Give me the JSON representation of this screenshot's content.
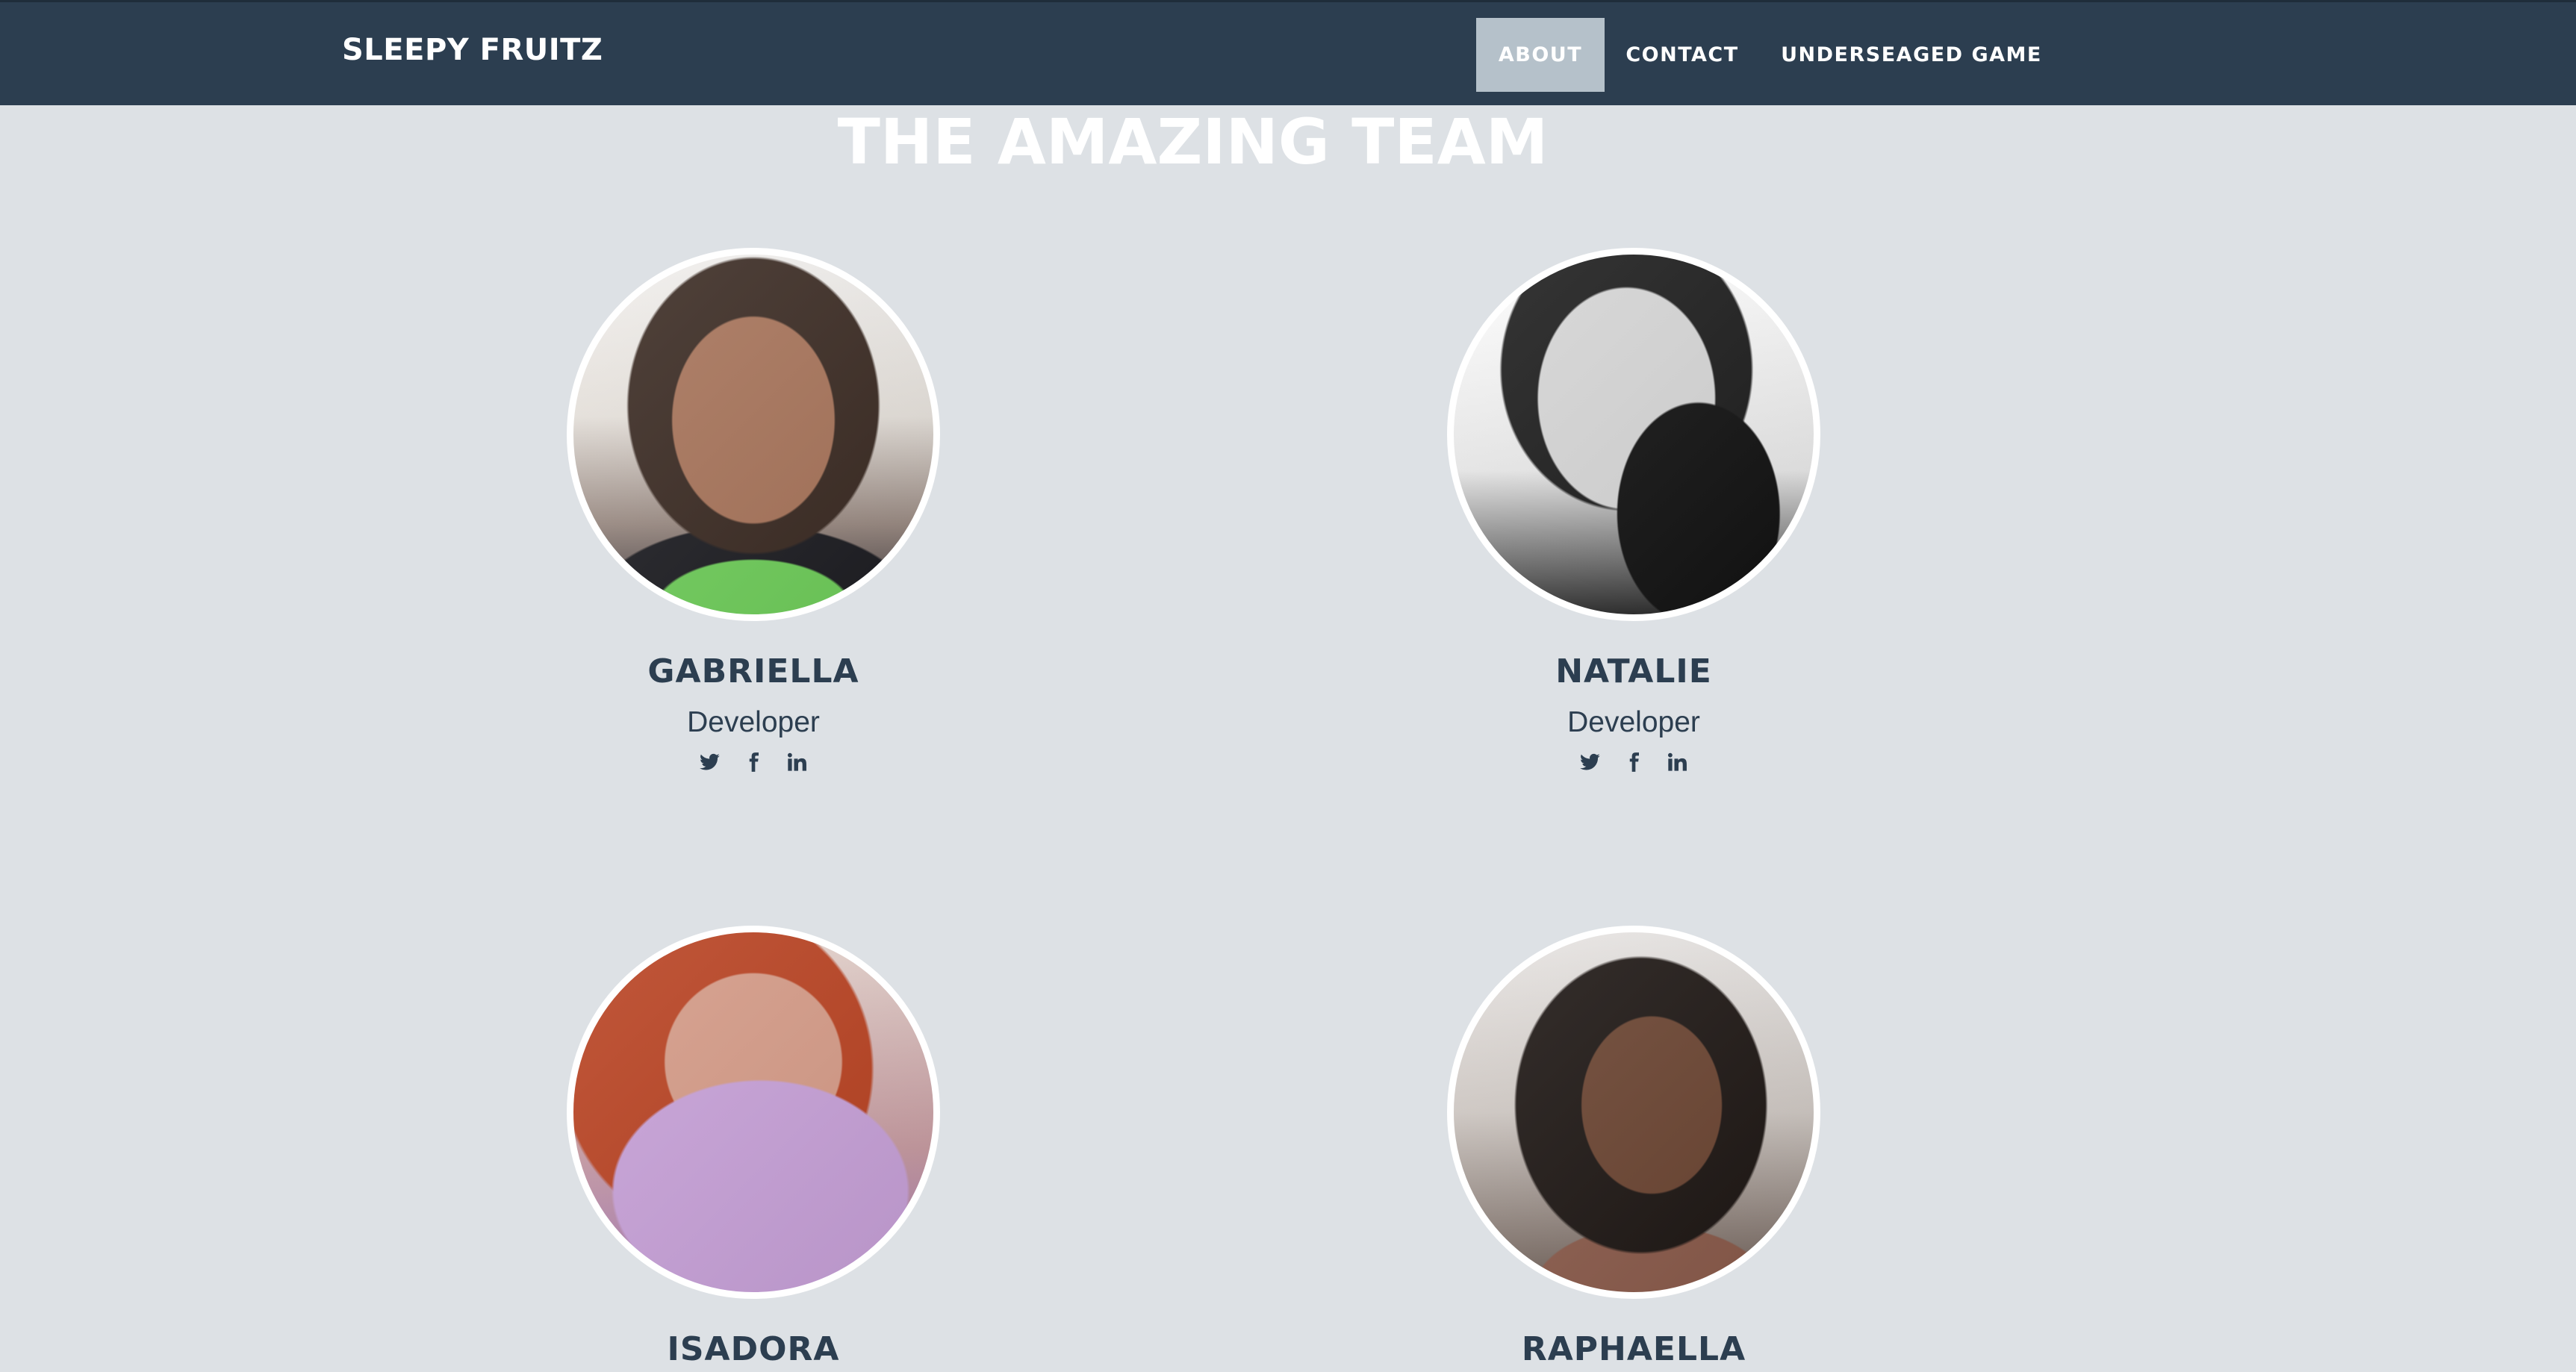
{
  "navbar": {
    "brand": "SLEEPY FRUITZ",
    "items": [
      {
        "label": "ABOUT",
        "active": true
      },
      {
        "label": "CONTACT",
        "active": false
      },
      {
        "label": "UNDERSEAGED GAME",
        "active": false
      }
    ]
  },
  "main": {
    "title": "THE AMAZING TEAM",
    "members": [
      {
        "name": "GABRIELLA",
        "role": "Developer",
        "socials": [
          "twitter-icon",
          "facebook-icon",
          "linkedin-icon"
        ]
      },
      {
        "name": "NATALIE",
        "role": "Developer",
        "socials": [
          "twitter-icon",
          "facebook-icon",
          "linkedin-icon"
        ]
      },
      {
        "name": "ISADORA"
      },
      {
        "name": "RAPHAELLA"
      }
    ]
  },
  "colors": {
    "navbar_bg": "#2c3e50",
    "active_nav_bg": "#b5c1ca",
    "page_bg": "#dde1e5",
    "text_dark": "#2c3e50",
    "title_text": "#ffffff"
  }
}
